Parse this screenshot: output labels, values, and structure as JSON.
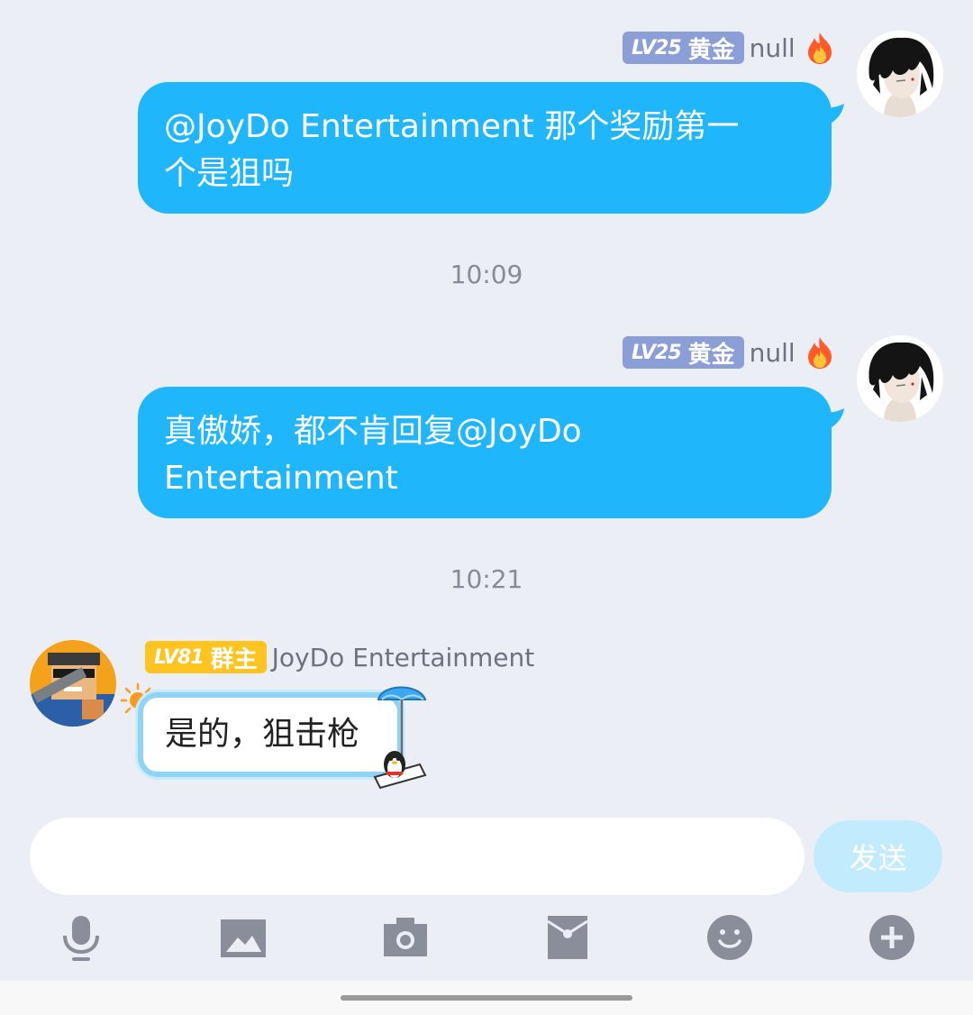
{
  "messages": [
    {
      "level": "LV25",
      "title": "黄金",
      "sender": "null",
      "text_line1": "@JoyDo Entertainment 那个奖励第一",
      "text_line2": "个是狙吗"
    },
    {
      "level": "LV25",
      "title": "黄金",
      "sender": "null",
      "text_line1": "真傲娇，都不肯回复@JoyDo",
      "text_line2": "Entertainment"
    }
  ],
  "timestamps": [
    "10:09",
    "10:21"
  ],
  "reply": {
    "level": "LV81",
    "title": "群主",
    "sender": "JoyDo Entertainment",
    "text": "是的，狙击枪"
  },
  "input": {
    "placeholder": "",
    "send_label": "发送"
  },
  "toolbar_icons": [
    "microphone-icon",
    "image-icon",
    "camera-icon",
    "red-packet-icon",
    "emoji-icon",
    "plus-icon"
  ],
  "colors": {
    "background": "#eceef5",
    "outgoing_bubble": "#20b6fb",
    "gold_badge": "#8c9ed6",
    "owner_badge": "#ffc41f",
    "send_button": "#c2ecfd",
    "toolbar_icon": "#8a8d9a"
  }
}
